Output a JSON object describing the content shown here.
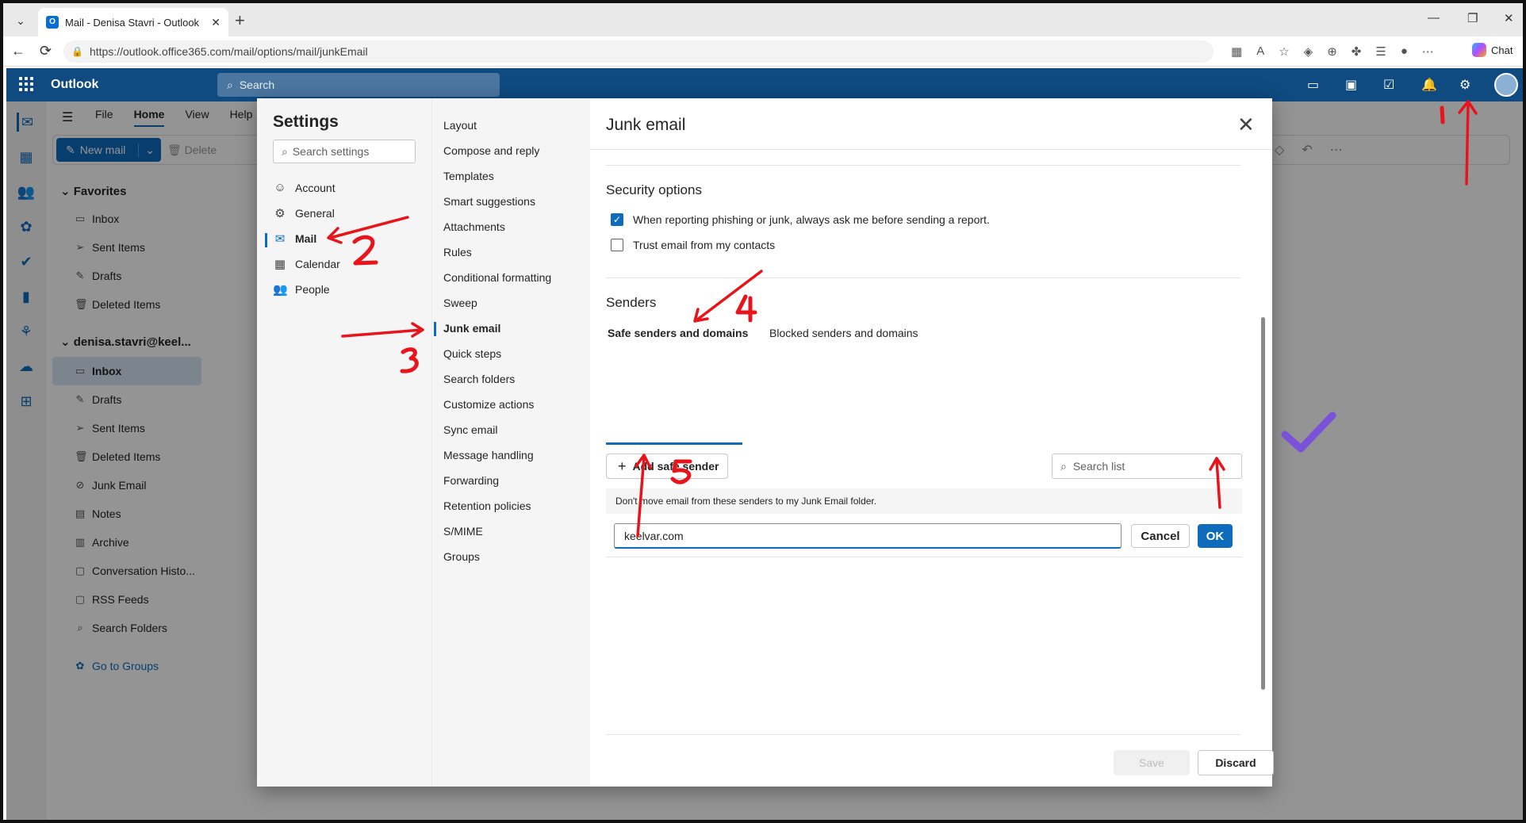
{
  "browser": {
    "tab_title": "Mail - Denisa Stavri - Outlook",
    "url": "https://outlook.office365.com/mail/options/mail/junkEmail",
    "chat_label": "Chat",
    "tab_icon_letter": "O"
  },
  "outlook": {
    "brand": "Outlook",
    "search_placeholder": "Search",
    "ribbon_tabs": [
      "File",
      "Home",
      "View",
      "Help"
    ],
    "new_mail_label": "New mail",
    "delete_label": "Delete"
  },
  "folders": {
    "favorites_header": "Favorites",
    "favorites": [
      {
        "label": "Inbox",
        "icon": "inbox-icon"
      },
      {
        "label": "Sent Items",
        "icon": "send-icon"
      },
      {
        "label": "Drafts",
        "icon": "pencil-icon"
      },
      {
        "label": "Deleted Items",
        "icon": "trash-icon"
      }
    ],
    "account_header": "denisa.stavri@keel...",
    "account_items": [
      {
        "label": "Inbox",
        "icon": "inbox-icon"
      },
      {
        "label": "Drafts",
        "icon": "pencil-icon"
      },
      {
        "label": "Sent Items",
        "icon": "send-icon"
      },
      {
        "label": "Deleted Items",
        "icon": "trash-icon"
      },
      {
        "label": "Junk Email",
        "icon": "junk-icon"
      },
      {
        "label": "Notes",
        "icon": "note-icon"
      },
      {
        "label": "Archive",
        "icon": "archive-icon"
      },
      {
        "label": "Conversation Histo...",
        "icon": "folder-icon"
      },
      {
        "label": "RSS Feeds",
        "icon": "folder-icon"
      },
      {
        "label": "Search Folders",
        "icon": "search-folder-icon"
      }
    ],
    "groups_link": "Go to Groups"
  },
  "settings": {
    "title": "Settings",
    "search_placeholder": "Search settings",
    "nav": [
      {
        "label": "Account",
        "icon": "person-icon"
      },
      {
        "label": "General",
        "icon": "gear-icon"
      },
      {
        "label": "Mail",
        "icon": "mail-icon"
      },
      {
        "label": "Calendar",
        "icon": "calendar-icon"
      },
      {
        "label": "People",
        "icon": "people-icon"
      }
    ],
    "mail_sections": [
      "Layout",
      "Compose and reply",
      "Templates",
      "Smart suggestions",
      "Attachments",
      "Rules",
      "Conditional formatting",
      "Sweep",
      "Junk email",
      "Quick steps",
      "Search folders",
      "Customize actions",
      "Sync email",
      "Message handling",
      "Forwarding",
      "Retention policies",
      "S/MIME",
      "Groups"
    ]
  },
  "junk": {
    "title": "Junk email",
    "security_header": "Security options",
    "option_ask": "When reporting phishing or junk, always ask me before sending a report.",
    "option_ask_checked": true,
    "option_trust": "Trust email from my contacts",
    "option_trust_checked": false,
    "senders_header": "Senders",
    "tab_safe": "Safe senders and domains",
    "tab_blocked": "Blocked senders and domains",
    "add_label": "Add safe sender",
    "search_placeholder": "Search list",
    "info": "Don't move email from these senders to my Junk Email folder.",
    "entry_value": "keelvar.com",
    "cancel": "Cancel",
    "ok": "OK",
    "save": "Save",
    "discard": "Discard"
  },
  "annotations": {
    "step1": "1",
    "step2": "2",
    "step3": "3",
    "step4": "4",
    "step5": "5",
    "arrow_color": "#e8141c",
    "check_color": "#7a52d9"
  }
}
